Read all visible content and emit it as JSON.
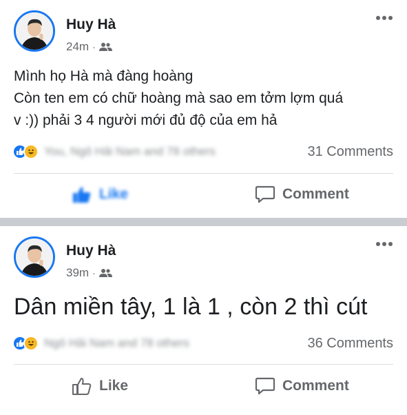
{
  "posts": [
    {
      "author": "Huy Hà",
      "time": "24m",
      "separator": "·",
      "text": "Mình họ Hà mà đàng hoàng\nCòn ten em có chữ hoàng mà sao em tởm lợm quá\nv :)) phải 3 4 người mới đủ độ của em hả",
      "reactors": "You, Ngô Hải Nam and 78 others",
      "comments": "31 Comments",
      "like_label": "Like",
      "comment_label": "Comment",
      "reaction_types": [
        "like",
        "haha"
      ]
    },
    {
      "author": "Huy Hà",
      "time": "39m",
      "separator": "·",
      "text": "Dân miền tây, 1 là 1 , còn 2 thì cút",
      "reactors": "Ngô Hải Nam and 78 others",
      "comments": "36 Comments",
      "like_label": "Like",
      "comment_label": "Comment",
      "reaction_types": [
        "like",
        "haha"
      ]
    }
  ],
  "icons": {
    "more": "more-options-icon",
    "audience": "friends-icon",
    "like": "thumbs-up-icon",
    "comment": "comment-bubble-icon"
  },
  "colors": {
    "accent": "#1877f2",
    "haha": "#f7b928",
    "secondary_text": "#65676b",
    "band": "#c9ccd1"
  }
}
